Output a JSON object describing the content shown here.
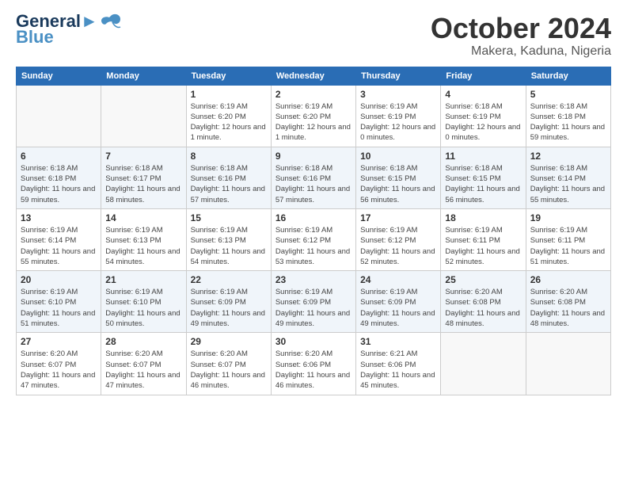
{
  "logo": {
    "line1": "General",
    "line2": "Blue"
  },
  "title": "October 2024",
  "location": "Makera, Kaduna, Nigeria",
  "weekdays": [
    "Sunday",
    "Monday",
    "Tuesday",
    "Wednesday",
    "Thursday",
    "Friday",
    "Saturday"
  ],
  "weeks": [
    [
      {
        "day": "",
        "sunrise": "",
        "sunset": "",
        "daylight": ""
      },
      {
        "day": "",
        "sunrise": "",
        "sunset": "",
        "daylight": ""
      },
      {
        "day": "1",
        "sunrise": "Sunrise: 6:19 AM",
        "sunset": "Sunset: 6:20 PM",
        "daylight": "Daylight: 12 hours and 1 minute."
      },
      {
        "day": "2",
        "sunrise": "Sunrise: 6:19 AM",
        "sunset": "Sunset: 6:20 PM",
        "daylight": "Daylight: 12 hours and 1 minute."
      },
      {
        "day": "3",
        "sunrise": "Sunrise: 6:19 AM",
        "sunset": "Sunset: 6:19 PM",
        "daylight": "Daylight: 12 hours and 0 minutes."
      },
      {
        "day": "4",
        "sunrise": "Sunrise: 6:18 AM",
        "sunset": "Sunset: 6:19 PM",
        "daylight": "Daylight: 12 hours and 0 minutes."
      },
      {
        "day": "5",
        "sunrise": "Sunrise: 6:18 AM",
        "sunset": "Sunset: 6:18 PM",
        "daylight": "Daylight: 11 hours and 59 minutes."
      }
    ],
    [
      {
        "day": "6",
        "sunrise": "Sunrise: 6:18 AM",
        "sunset": "Sunset: 6:18 PM",
        "daylight": "Daylight: 11 hours and 59 minutes."
      },
      {
        "day": "7",
        "sunrise": "Sunrise: 6:18 AM",
        "sunset": "Sunset: 6:17 PM",
        "daylight": "Daylight: 11 hours and 58 minutes."
      },
      {
        "day": "8",
        "sunrise": "Sunrise: 6:18 AM",
        "sunset": "Sunset: 6:16 PM",
        "daylight": "Daylight: 11 hours and 57 minutes."
      },
      {
        "day": "9",
        "sunrise": "Sunrise: 6:18 AM",
        "sunset": "Sunset: 6:16 PM",
        "daylight": "Daylight: 11 hours and 57 minutes."
      },
      {
        "day": "10",
        "sunrise": "Sunrise: 6:18 AM",
        "sunset": "Sunset: 6:15 PM",
        "daylight": "Daylight: 11 hours and 56 minutes."
      },
      {
        "day": "11",
        "sunrise": "Sunrise: 6:18 AM",
        "sunset": "Sunset: 6:15 PM",
        "daylight": "Daylight: 11 hours and 56 minutes."
      },
      {
        "day": "12",
        "sunrise": "Sunrise: 6:18 AM",
        "sunset": "Sunset: 6:14 PM",
        "daylight": "Daylight: 11 hours and 55 minutes."
      }
    ],
    [
      {
        "day": "13",
        "sunrise": "Sunrise: 6:19 AM",
        "sunset": "Sunset: 6:14 PM",
        "daylight": "Daylight: 11 hours and 55 minutes."
      },
      {
        "day": "14",
        "sunrise": "Sunrise: 6:19 AM",
        "sunset": "Sunset: 6:13 PM",
        "daylight": "Daylight: 11 hours and 54 minutes."
      },
      {
        "day": "15",
        "sunrise": "Sunrise: 6:19 AM",
        "sunset": "Sunset: 6:13 PM",
        "daylight": "Daylight: 11 hours and 54 minutes."
      },
      {
        "day": "16",
        "sunrise": "Sunrise: 6:19 AM",
        "sunset": "Sunset: 6:12 PM",
        "daylight": "Daylight: 11 hours and 53 minutes."
      },
      {
        "day": "17",
        "sunrise": "Sunrise: 6:19 AM",
        "sunset": "Sunset: 6:12 PM",
        "daylight": "Daylight: 11 hours and 52 minutes."
      },
      {
        "day": "18",
        "sunrise": "Sunrise: 6:19 AM",
        "sunset": "Sunset: 6:11 PM",
        "daylight": "Daylight: 11 hours and 52 minutes."
      },
      {
        "day": "19",
        "sunrise": "Sunrise: 6:19 AM",
        "sunset": "Sunset: 6:11 PM",
        "daylight": "Daylight: 11 hours and 51 minutes."
      }
    ],
    [
      {
        "day": "20",
        "sunrise": "Sunrise: 6:19 AM",
        "sunset": "Sunset: 6:10 PM",
        "daylight": "Daylight: 11 hours and 51 minutes."
      },
      {
        "day": "21",
        "sunrise": "Sunrise: 6:19 AM",
        "sunset": "Sunset: 6:10 PM",
        "daylight": "Daylight: 11 hours and 50 minutes."
      },
      {
        "day": "22",
        "sunrise": "Sunrise: 6:19 AM",
        "sunset": "Sunset: 6:09 PM",
        "daylight": "Daylight: 11 hours and 49 minutes."
      },
      {
        "day": "23",
        "sunrise": "Sunrise: 6:19 AM",
        "sunset": "Sunset: 6:09 PM",
        "daylight": "Daylight: 11 hours and 49 minutes."
      },
      {
        "day": "24",
        "sunrise": "Sunrise: 6:19 AM",
        "sunset": "Sunset: 6:09 PM",
        "daylight": "Daylight: 11 hours and 49 minutes."
      },
      {
        "day": "25",
        "sunrise": "Sunrise: 6:20 AM",
        "sunset": "Sunset: 6:08 PM",
        "daylight": "Daylight: 11 hours and 48 minutes."
      },
      {
        "day": "26",
        "sunrise": "Sunrise: 6:20 AM",
        "sunset": "Sunset: 6:08 PM",
        "daylight": "Daylight: 11 hours and 48 minutes."
      }
    ],
    [
      {
        "day": "27",
        "sunrise": "Sunrise: 6:20 AM",
        "sunset": "Sunset: 6:07 PM",
        "daylight": "Daylight: 11 hours and 47 minutes."
      },
      {
        "day": "28",
        "sunrise": "Sunrise: 6:20 AM",
        "sunset": "Sunset: 6:07 PM",
        "daylight": "Daylight: 11 hours and 47 minutes."
      },
      {
        "day": "29",
        "sunrise": "Sunrise: 6:20 AM",
        "sunset": "Sunset: 6:07 PM",
        "daylight": "Daylight: 11 hours and 46 minutes."
      },
      {
        "day": "30",
        "sunrise": "Sunrise: 6:20 AM",
        "sunset": "Sunset: 6:06 PM",
        "daylight": "Daylight: 11 hours and 46 minutes."
      },
      {
        "day": "31",
        "sunrise": "Sunrise: 6:21 AM",
        "sunset": "Sunset: 6:06 PM",
        "daylight": "Daylight: 11 hours and 45 minutes."
      },
      {
        "day": "",
        "sunrise": "",
        "sunset": "",
        "daylight": ""
      },
      {
        "day": "",
        "sunrise": "",
        "sunset": "",
        "daylight": ""
      }
    ]
  ]
}
